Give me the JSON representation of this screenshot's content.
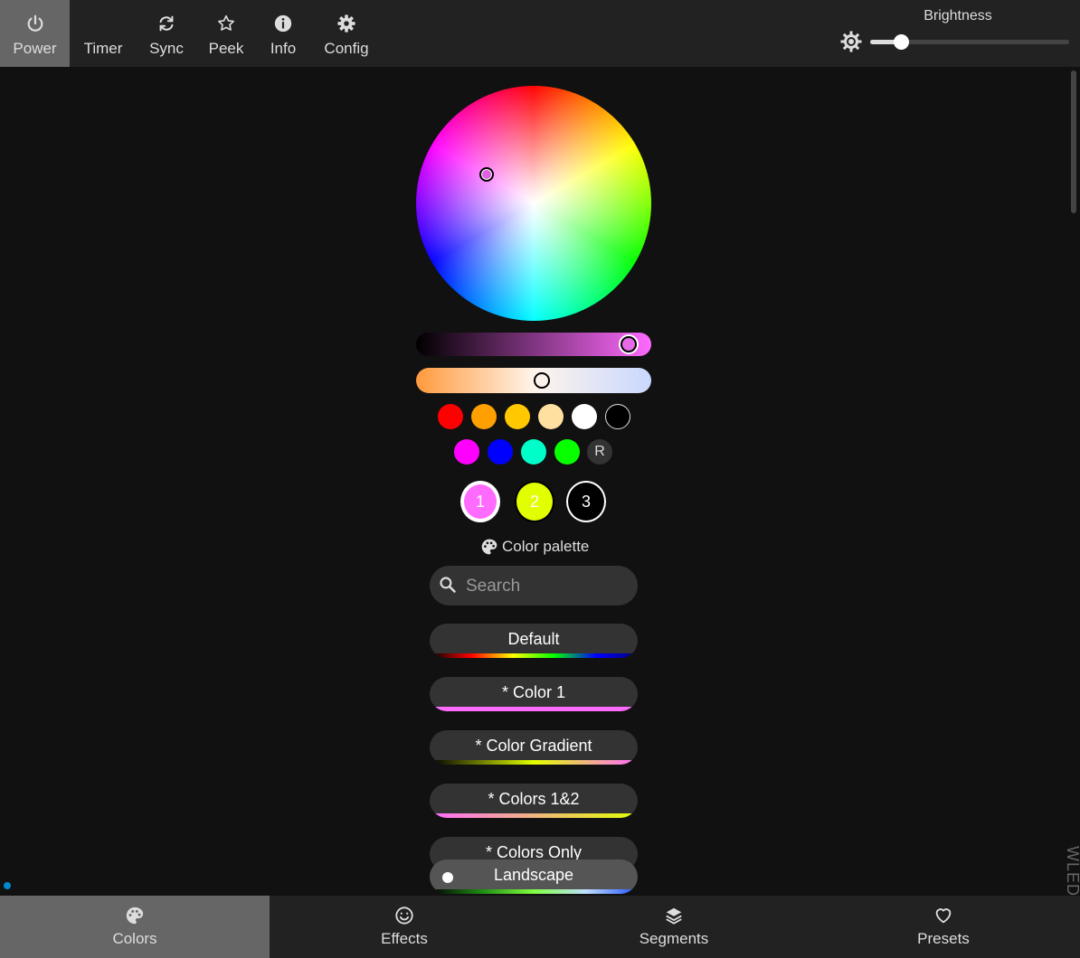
{
  "topbar": {
    "buttons": [
      {
        "label": "Power",
        "icon": "power-icon",
        "active": true
      },
      {
        "label": "Timer",
        "icon": "moon-icon"
      },
      {
        "label": "Sync",
        "icon": "sync-icon"
      },
      {
        "label": "Peek",
        "icon": "star-icon"
      },
      {
        "label": "Info",
        "icon": "info-icon"
      },
      {
        "label": "Config",
        "icon": "gear-icon"
      }
    ],
    "brightness": {
      "label": "Brightness",
      "value": 0.12
    }
  },
  "color_picker": {
    "value_slider_level": 0.95,
    "kelvin_slider_level": 0.54,
    "quick_colors_row1": [
      "#ff0000",
      "#ffa000",
      "#ffc800",
      "#ffe0a0",
      "#ffffff",
      "#000000"
    ],
    "quick_colors_row2": [
      "#ff00ff",
      "#0000ff",
      "#00ffc8",
      "#08ff00"
    ],
    "random_label": "R",
    "slots": [
      {
        "label": "1",
        "color": "#ff6aff"
      },
      {
        "label": "2",
        "color": "#e1ff00"
      },
      {
        "label": "3",
        "color": "#000000"
      }
    ]
  },
  "palette": {
    "heading": "Color palette",
    "search_placeholder": "Search",
    "items": [
      {
        "name": "Default",
        "gradient": "linear-gradient(to right,#000,#ff0000,#ffff00,#00ff00,#0000ff,#000080)"
      },
      {
        "name": "* Color 1",
        "gradient": "linear-gradient(to right,#ff6aff,#ff6aff)"
      },
      {
        "name": "* Color Gradient",
        "gradient": "linear-gradient(to right,#000,#e1ff00,#ff6aff)"
      },
      {
        "name": "* Colors 1&2",
        "gradient": "linear-gradient(to right,#ff6aff,#e1ff00)"
      },
      {
        "name": "* Colors Only",
        "gradient": "linear-gradient(to right,#ff6aff,#e1ff00,#000)"
      },
      {
        "name": "Landscape",
        "gradient": "linear-gradient(to right,#000,#1e8c14,#80ff40,#c0e0ff,#2050ff)"
      }
    ]
  },
  "branding": {
    "logo": "WLED"
  },
  "bottombar": {
    "tabs": [
      {
        "label": "Colors",
        "icon": "palette-icon",
        "active": true
      },
      {
        "label": "Effects",
        "icon": "smiley-icon"
      },
      {
        "label": "Segments",
        "icon": "layers-icon"
      },
      {
        "label": "Presets",
        "icon": "heart-icon"
      }
    ]
  }
}
